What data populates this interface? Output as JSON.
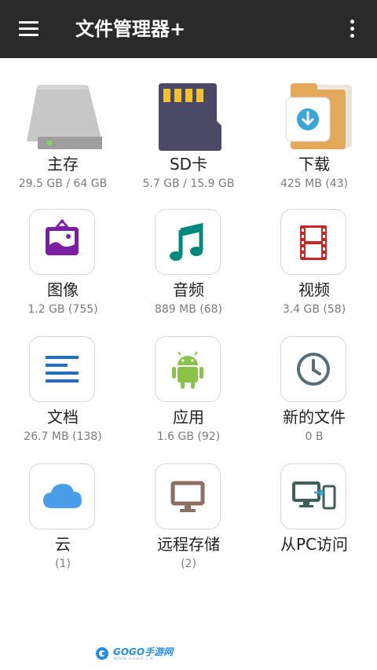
{
  "app_bar": {
    "title": "文件管理器+",
    "menu_icon": "hamburger-menu-icon",
    "more_icon": "more-vertical-icon"
  },
  "items": [
    {
      "label": "主存",
      "sub": "29.5 GB / 64 GB",
      "icon": "hard-drive-icon"
    },
    {
      "label": "SD卡",
      "sub": "5.7 GB / 15.9 GB",
      "icon": "sd-card-icon"
    },
    {
      "label": "下载",
      "sub": "425 MB (43)",
      "icon": "download-folder-icon"
    },
    {
      "label": "图像",
      "sub": "1.2 GB (755)",
      "icon": "image-icon"
    },
    {
      "label": "音频",
      "sub": "889 MB (68)",
      "icon": "music-note-icon"
    },
    {
      "label": "视频",
      "sub": "3.4 GB (58)",
      "icon": "film-icon"
    },
    {
      "label": "文档",
      "sub": "26.7 MB (138)",
      "icon": "document-icon"
    },
    {
      "label": "应用",
      "sub": "1.6 GB (92)",
      "icon": "android-icon"
    },
    {
      "label": "新的文件",
      "sub": "0 B",
      "icon": "clock-icon"
    },
    {
      "label": "云",
      "sub": "(1)",
      "icon": "cloud-icon"
    },
    {
      "label": "远程存储",
      "sub": "(2)",
      "icon": "monitor-icon"
    },
    {
      "label": "从PC访问",
      "sub": "",
      "icon": "pc-to-phone-icon"
    }
  ],
  "colors": {
    "app_bar": "#2a2a2a",
    "image": "#7b1fa2",
    "audio": "#00897b",
    "video": "#c62828",
    "document": "#1e6fc7",
    "android": "#8bc34a",
    "clock": "#546e7a",
    "cloud": "#4a9de8",
    "monitor": "#8d6e63",
    "pc": "#3e5f5a"
  },
  "watermark": {
    "text": "GOGO手游网",
    "sub": "WWW.GOGO.CN"
  }
}
